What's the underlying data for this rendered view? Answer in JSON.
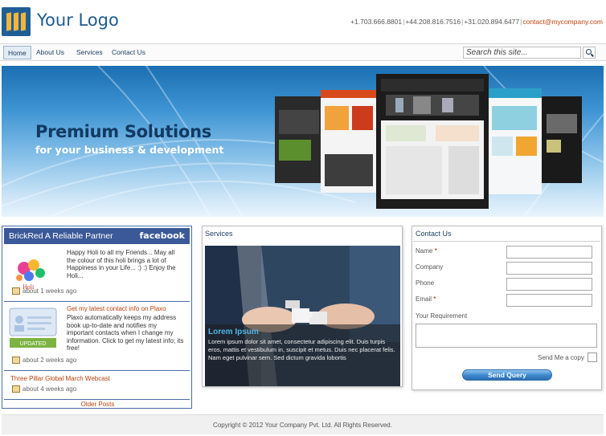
{
  "header": {
    "logo_text": "Your Logo",
    "phones": [
      "+1.703.666.8801",
      "+44.208.816.7516",
      "+31.020.894.6477"
    ],
    "email": "contact@mycompany.com"
  },
  "nav": {
    "items": [
      {
        "label": "Home",
        "active": true
      },
      {
        "label": "About Us",
        "active": false
      },
      {
        "label": "Services",
        "active": false
      },
      {
        "label": "Contact Us",
        "active": false
      }
    ],
    "search_placeholder": "Search this site..."
  },
  "banner": {
    "title": "Premium Solutions",
    "subtitle": "for your business & development"
  },
  "facebook": {
    "header": "BrickRed A Reliable Partner",
    "brand": "facebook",
    "posts": [
      {
        "title": "",
        "text": "Happy Holi to all my Friends... May all the colour of this holi brings a lot of Happiness in your Life... :) :) Enjoy the Holi...",
        "time": "about 1 weeks ago"
      },
      {
        "title": "Get my latest contact info on Plaxo",
        "text": "Plaxo automatically keeps my address book up-to-date and notifies my important contacts when I change my information. Click to get my latest info; its free!",
        "time": "about 2 weeks ago",
        "thumb_badge": "UPDATED"
      },
      {
        "title": "Three Pillar Global March Webcast",
        "text": "",
        "time": "about 4 weeks ago"
      }
    ],
    "older_posts": "Older Posts"
  },
  "services": {
    "heading": "Services",
    "caption_title": "Lorem Ipsum",
    "caption_text": "Lorem ipsum dolor sit amet, consectetur adipiscing elit. Duis turpis eros, mattis et vestibulum in, suscipit et metus. Duis nec placerat felis. Nam eget pulvinar sem. Sed dictum gravida lobortis"
  },
  "contact": {
    "heading": "Contact Us",
    "fields": [
      {
        "label": "Name",
        "required": true
      },
      {
        "label": "Company",
        "required": false
      },
      {
        "label": "Phone",
        "required": false
      },
      {
        "label": "Email",
        "required": true
      }
    ],
    "requirement_label": "Your Requirement",
    "copy_label": "Send Me a copy",
    "submit_label": "Send Query"
  },
  "footer": {
    "copyright": "Copyright © 2012 Your Company Pvt. Ltd. All Rights Reserved."
  },
  "colors": {
    "brand_blue": "#1d5a92",
    "facebook_blue": "#3b5998",
    "link_orange": "#b8420e"
  }
}
